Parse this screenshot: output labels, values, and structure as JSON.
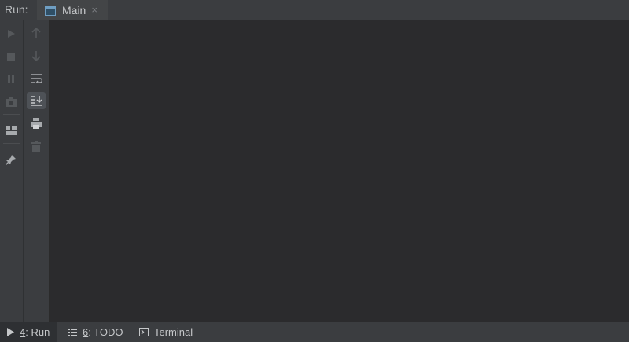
{
  "header": {
    "run_label": "Run:",
    "tab": {
      "title": "Main",
      "close": "×",
      "icon": "run-config-icon"
    }
  },
  "toolbar_left": [
    {
      "name": "rerun-icon"
    },
    {
      "name": "stop-icon"
    },
    {
      "name": "pause-icon"
    },
    {
      "name": "camera-icon"
    },
    {
      "name": "layout-icon"
    },
    {
      "name": "pin-icon"
    }
  ],
  "toolbar_right": [
    {
      "name": "up-arrow-icon"
    },
    {
      "name": "down-arrow-icon"
    },
    {
      "name": "soft-wrap-icon"
    },
    {
      "name": "scroll-to-end-icon"
    },
    {
      "name": "print-icon"
    },
    {
      "name": "trash-icon"
    }
  ],
  "statusbar": {
    "run": {
      "num": "4",
      "label": ": Run"
    },
    "todo": {
      "num": "6",
      "label": ": TODO"
    },
    "terminal": {
      "label": "Terminal"
    }
  },
  "colors": {
    "background": "#2b2b2d",
    "panel": "#3b3d40",
    "text": "#c5c7c9",
    "accent": "#4c9bd5"
  }
}
